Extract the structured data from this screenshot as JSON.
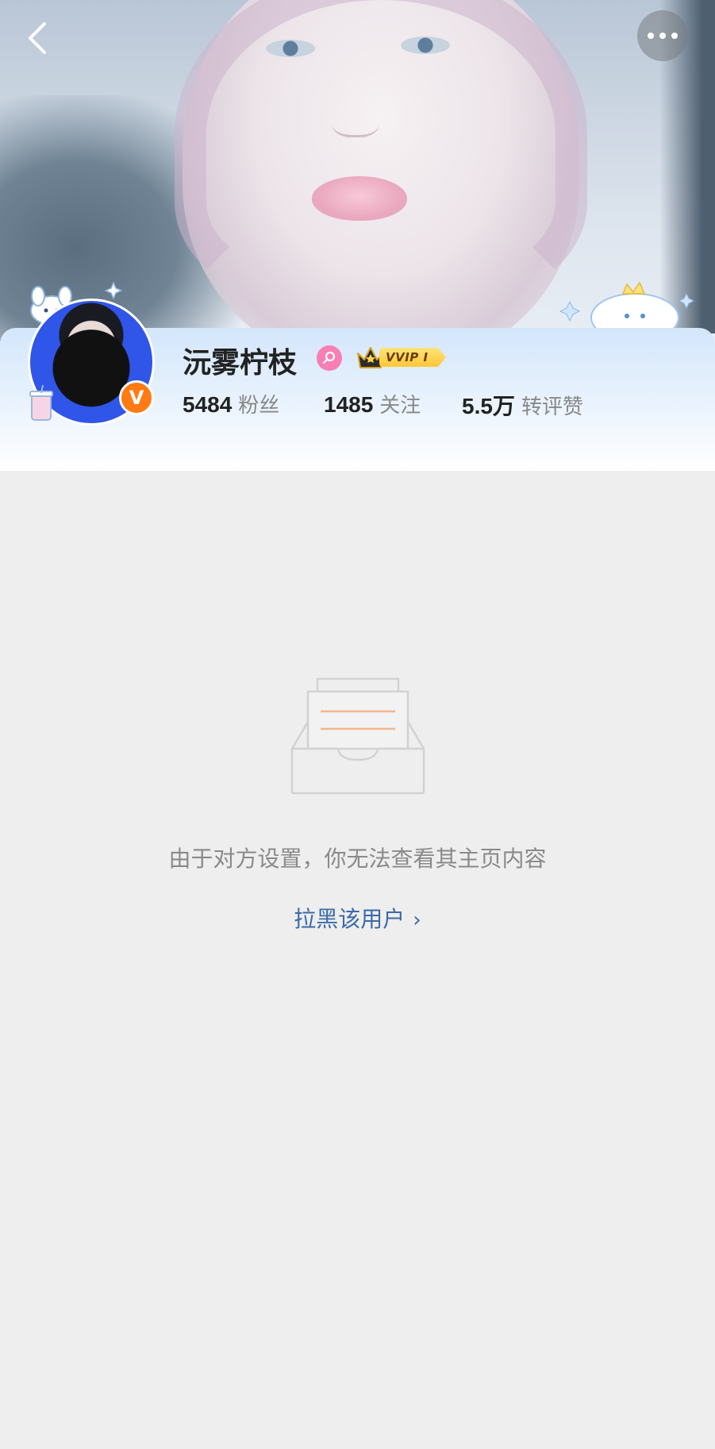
{
  "header": {
    "back_icon": "back-chevron-icon",
    "more_icon": "more-dots-icon"
  },
  "profile": {
    "name": "沅雾柠枝",
    "gender_icon": "female-icon",
    "verified_badge": "V",
    "vip_label": "VVIP I",
    "stats": [
      {
        "num": "5484",
        "label": "粉丝"
      },
      {
        "num": "1485",
        "label": "关注"
      },
      {
        "num": "5.5万",
        "label": "转评赞"
      }
    ]
  },
  "empty_state": {
    "icon": "empty-inbox-icon",
    "message": "由于对方设置，你无法查看其主页内容",
    "block_link": "拉黑该用户",
    "block_chevron": "›"
  },
  "colors": {
    "accent_link": "#3b6aa6",
    "vip_gold": "#ffc636",
    "badge_orange": "#ff7a12",
    "avatar_bg": "#2f56e8"
  }
}
